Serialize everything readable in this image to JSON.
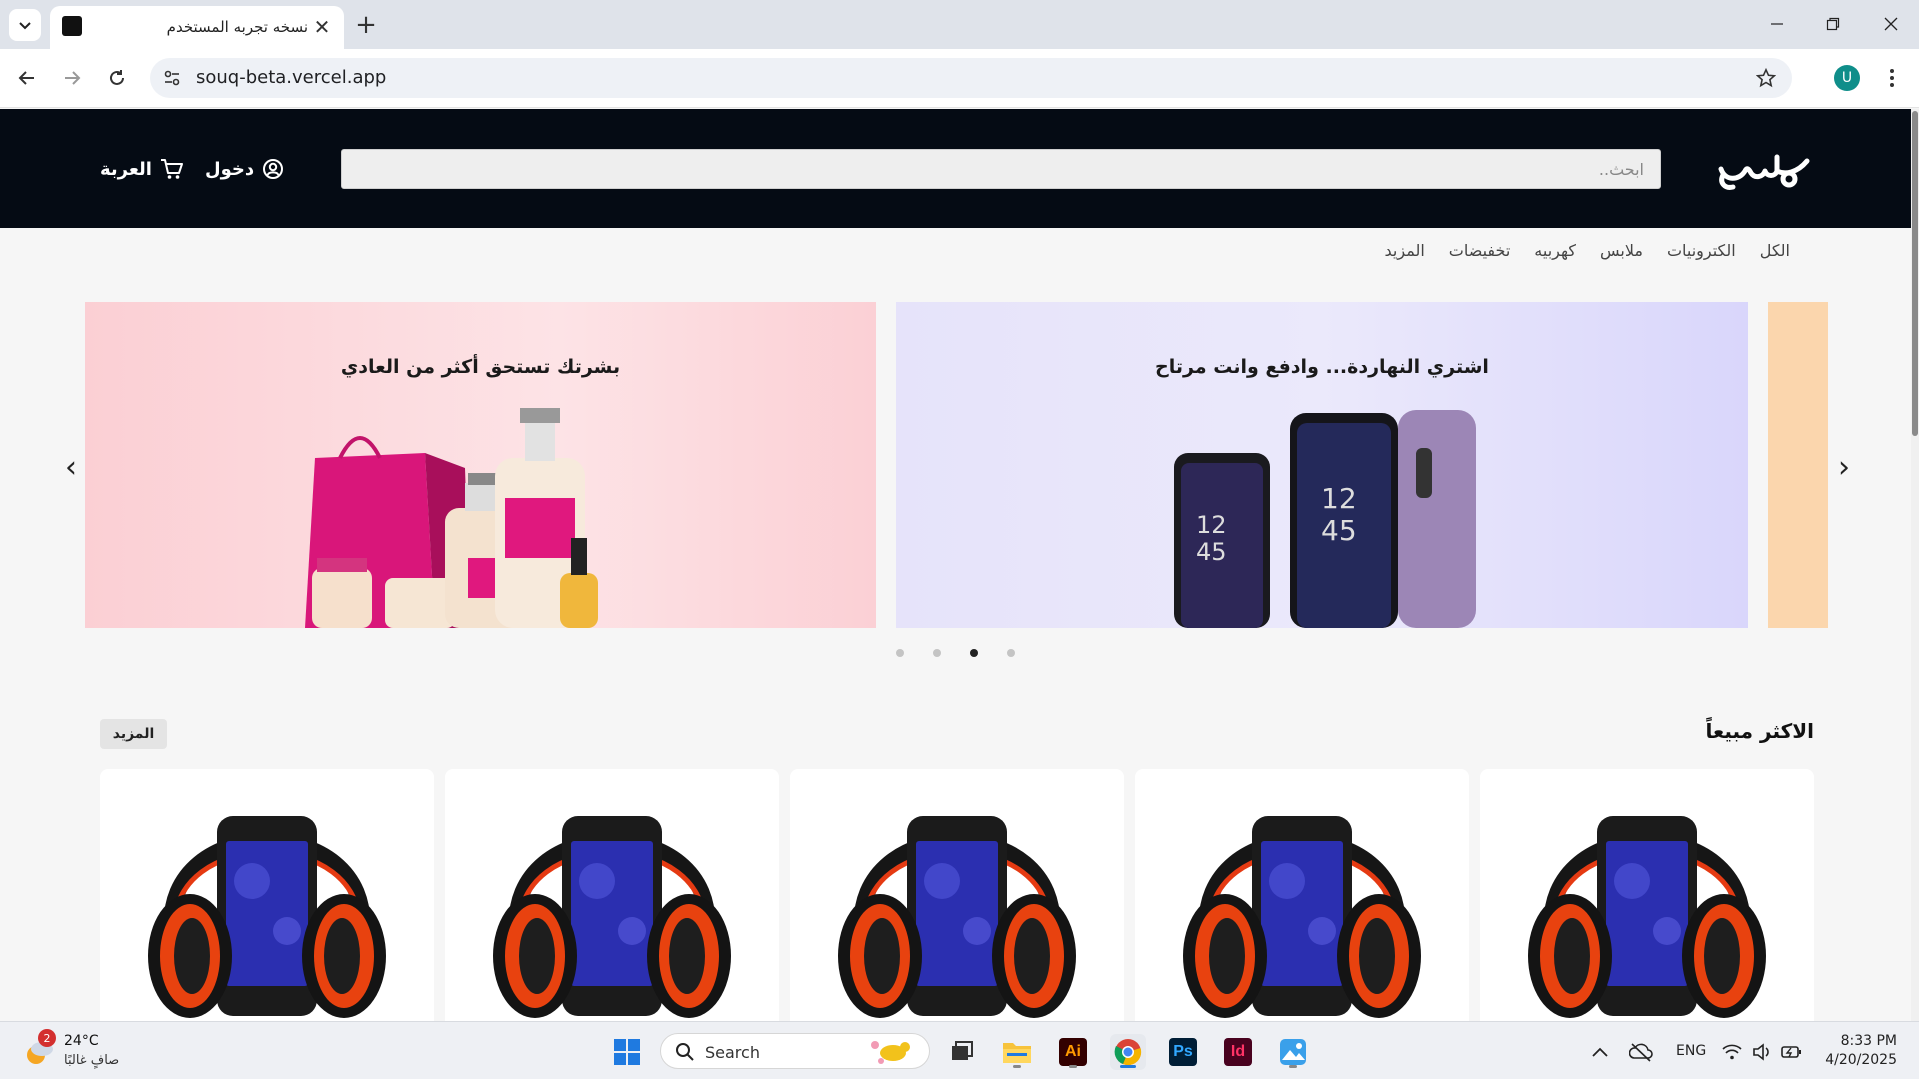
{
  "browser": {
    "tab_title": "نسخه تجربه المستخدم",
    "url": "souq-beta.vercel.app",
    "profile_initial": "U"
  },
  "header": {
    "logo_alt": "سوق",
    "search_placeholder": "ابحث..",
    "login_label": "دخول",
    "cart_label": "العربة"
  },
  "categories": [
    "الكل",
    "الكترونيات",
    "ملابس",
    "كهربيه",
    "تخفيضات",
    "المزيد"
  ],
  "carousel": {
    "slides": [
      {
        "title": "اشتري النهاردة... وادفع وانت مرتاح",
        "bg_from": "#e8e4fa",
        "bg_to": "#d9d5fb",
        "image": "smartphones"
      },
      {
        "title": "بشرتك تستحق أكثر من العادي",
        "bg_from": "#fde3e6",
        "bg_to": "#fbcfd4",
        "image": "skincare-products"
      }
    ],
    "peek_color": "#fbd6ad",
    "dots": 4,
    "active_dot": 2
  },
  "best_sellers": {
    "title": "الاكثر مبيعاً",
    "more_label": "المزيد",
    "product_count": 5,
    "product_image": "headphones-phone"
  },
  "taskbar": {
    "weather_temp": "24°C",
    "weather_desc": "صافٍ غالبًا",
    "weather_badge": "2",
    "search_label": "Search",
    "language": "ENG",
    "time": "8:33 PM",
    "date": "4/20/2025",
    "apps": [
      "windows-start",
      "file-explorer",
      "adobe-illustrator",
      "chrome",
      "photoshop",
      "indesign",
      "photos"
    ]
  },
  "colors": {
    "header_bg": "#050b14",
    "accent": "#0f8e8a"
  }
}
